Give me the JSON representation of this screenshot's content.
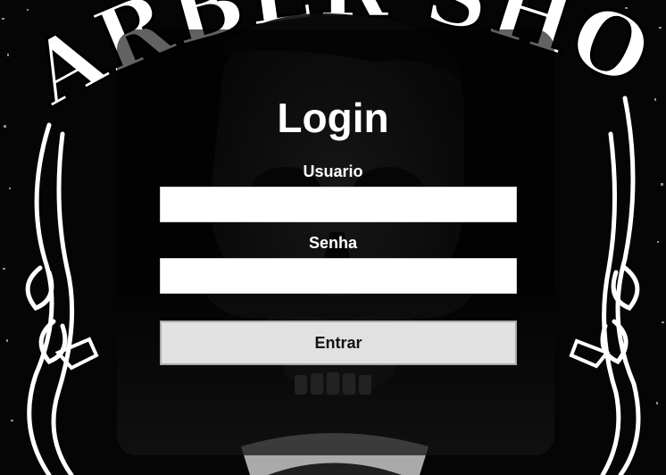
{
  "background": {
    "banner_text": "BARBER SHOP",
    "colors": {
      "background": "#050505",
      "ornament": "#ffffff",
      "panel": "#000000"
    }
  },
  "login": {
    "title": "Login",
    "username_label": "Usuario",
    "username_value": "",
    "password_label": "Senha",
    "password_value": "",
    "submit_label": "Entrar"
  }
}
